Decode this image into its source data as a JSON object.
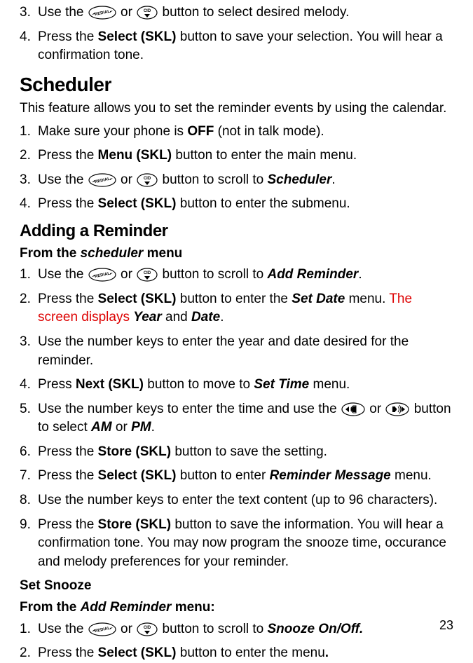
{
  "intro_list": [
    {
      "num": "3.",
      "pre": "Use the ",
      "post": " button to select desired melody."
    },
    {
      "num": "4.",
      "text_parts": [
        "Press the ",
        "Select (SKL)",
        " button to save your selection. You will hear a confirmation tone."
      ]
    }
  ],
  "scheduler": {
    "title": "Scheduler",
    "intro": "This feature allows you to set the reminder events by using the calendar.",
    "steps": [
      {
        "num": "1.",
        "parts": [
          "Make sure your phone is ",
          "OFF",
          " (not in talk mode)."
        ]
      },
      {
        "num": "2.",
        "parts": [
          "Press the ",
          "Menu (SKL)",
          " button to enter the main menu."
        ]
      },
      {
        "num": "3.",
        "pre": "Use the ",
        "mid": " button to scroll to ",
        "target": "Scheduler",
        "post": "."
      },
      {
        "num": "4.",
        "parts": [
          "Press the ",
          "Select (SKL)",
          " button to enter the submenu."
        ]
      }
    ]
  },
  "adding": {
    "title": "Adding a Reminder",
    "sub_pre": "From the ",
    "sub_i": "scheduler",
    "sub_post": " menu",
    "steps": {
      "s1": {
        "num": "1.",
        "pre": "Use the ",
        "mid": " button to scroll to ",
        "target": "Add Reminder",
        "post": "."
      },
      "s2": {
        "num": "2.",
        "a": "Press the ",
        "b": "Select (SKL)",
        "c": " button to enter the ",
        "d": "Set Date",
        "e": " menu. ",
        "red": "The screen displays ",
        "f": "Year",
        "g": " and ",
        "h": "Date",
        "i": "."
      },
      "s3": {
        "num": "3.",
        "text": "Use the number keys to enter the year and date desired for the reminder."
      },
      "s4": {
        "num": "4.",
        "a": "Press ",
        "b": "Next (SKL)",
        "c": " button to move to ",
        "d": "Set Time",
        "e": " menu."
      },
      "s5": {
        "num": "5.",
        "a": "Use the number keys to enter the time and use the ",
        "b": " button to select ",
        "c": "AM",
        "d": " or ",
        "e": "PM",
        "f": "."
      },
      "s6": {
        "num": "6.",
        "a": "Press the ",
        "b": "Store (SKL)",
        "c": " button to save the setting."
      },
      "s7": {
        "num": "7.",
        "a": "Press the ",
        "b": "Select (SKL)",
        "c": " button to enter ",
        "d": "Reminder Message",
        "e": " menu."
      },
      "s8": {
        "num": "8.",
        "text": "Use the number keys to enter the text content (up to 96 characters)."
      },
      "s9": {
        "num": "9.",
        "a": "Press the ",
        "b": "Store (SKL)",
        "c": " button to save the information. You will hear a confirmation tone. You may now program the snooze time, occurance and melody preferences for your reminder."
      }
    }
  },
  "snooze": {
    "title": "Set Snooze",
    "sub_pre": "From the ",
    "sub_i": "Add Reminder",
    "sub_post": " menu:",
    "steps": {
      "s1": {
        "num": "1.",
        "pre": "Use the ",
        "mid": " button to scroll to ",
        "target": "Snooze On/Off.",
        "post": ""
      },
      "s2": {
        "num": "2.",
        "a": "Press the ",
        "b": "Select (SKL)",
        "c": " button to enter the menu",
        "d": "."
      }
    }
  },
  "or": " or ",
  "page": "23"
}
